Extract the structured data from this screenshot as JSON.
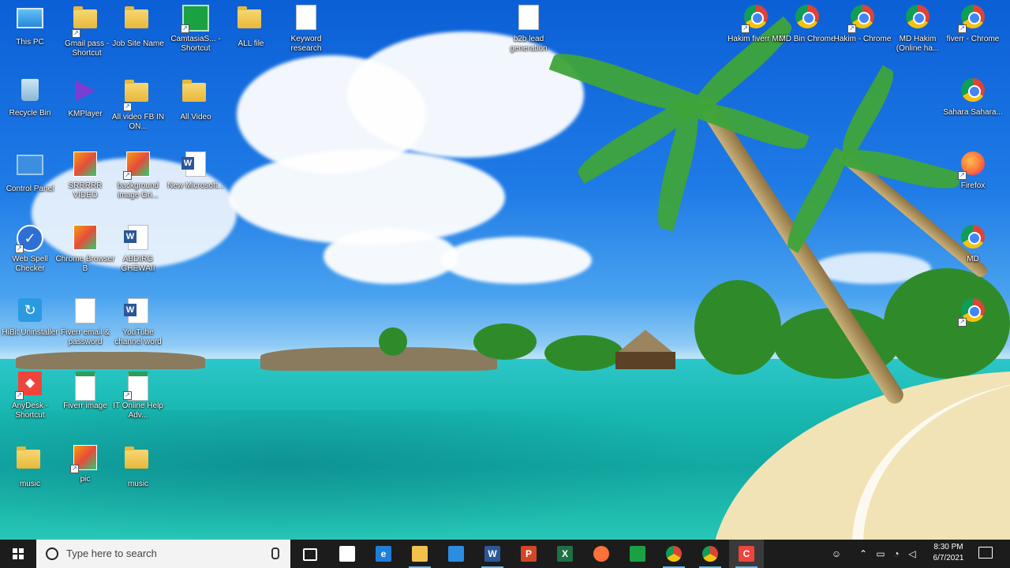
{
  "desktop_icons": [
    {
      "name": "this-pc",
      "label": "This PC",
      "type": "pc"
    },
    {
      "name": "gmail-pass",
      "label": "Gmail pass - Shortcut",
      "type": "folder"
    },
    {
      "name": "job-site-name",
      "label": "Job Site Name",
      "type": "folder"
    },
    {
      "name": "camtasia",
      "label": "CamtasiaS... - Shortcut",
      "type": "camtasia"
    },
    {
      "name": "all-file",
      "label": "ALL file",
      "type": "folder"
    },
    {
      "name": "keyword-research",
      "label": "Keyword research",
      "type": "doc"
    },
    {
      "name": "b2b-lead",
      "label": "b2b lead generation",
      "type": "doc"
    },
    {
      "name": "recycle-bin",
      "label": "Recycle Bin",
      "type": "bin"
    },
    {
      "name": "kmplayer",
      "label": "KMPlayer",
      "type": "kmp"
    },
    {
      "name": "all-video-fb",
      "label": "All video FB IN ON...",
      "type": "folder"
    },
    {
      "name": "all-video",
      "label": "All Video",
      "type": "folder"
    },
    {
      "name": "control-panel",
      "label": "Control Panel",
      "type": "cp"
    },
    {
      "name": "img-file-1",
      "label": "SRRRRR VIDEO",
      "type": "img"
    },
    {
      "name": "background-image",
      "label": "background image Gri...",
      "type": "img"
    },
    {
      "name": "new-microsoft",
      "label": "New Microsoft...",
      "type": "word"
    },
    {
      "name": "spell-checker",
      "label": "Web Spell Checker",
      "type": "check"
    },
    {
      "name": "chrome-browser",
      "label": "Chrome Browser B",
      "type": "img"
    },
    {
      "name": "word-file-2",
      "label": "ABDIRG GHEWAII",
      "type": "word"
    },
    {
      "name": "uninstaller",
      "label": "HiBit Uninstaller",
      "type": "uni"
    },
    {
      "name": "fiverr-email",
      "label": "Fiverr email & password",
      "type": "doc"
    },
    {
      "name": "youtube-word",
      "label": "YouTube channel word",
      "type": "word"
    },
    {
      "name": "anydesk",
      "label": "AnyDesk - Shortcut",
      "type": "anydesk"
    },
    {
      "name": "fiverr-image",
      "label": "Fiverr image",
      "type": "pdf"
    },
    {
      "name": "it-online-help",
      "label": "IT Online Help Adv...",
      "type": "pdf"
    },
    {
      "name": "folder-music",
      "label": "music",
      "type": "folder"
    },
    {
      "name": "folder-pic",
      "label": "pic",
      "type": "img"
    },
    {
      "name": "folder-music-2",
      "label": "music",
      "type": "folder"
    },
    {
      "name": "chrome-hakim-fiverr",
      "label": "Hakim fiverr MD",
      "type": "chrome"
    },
    {
      "name": "chrome-md-bin",
      "label": "MD Bin Chrome",
      "type": "chrome"
    },
    {
      "name": "chrome-hakim",
      "label": "Hakim - Chrome",
      "type": "chrome"
    },
    {
      "name": "chrome-md-hakim",
      "label": "MD Hakim (Online ha...",
      "type": "chrome"
    },
    {
      "name": "chrome-fiverr",
      "label": "fiverr - Chrome",
      "type": "chrome"
    },
    {
      "name": "chrome-sahara",
      "label": "Sahara Sahara...",
      "type": "chrome"
    },
    {
      "name": "firefox",
      "label": "Firefox",
      "type": "firefox"
    },
    {
      "name": "chrome-md",
      "label": "MD",
      "type": "chrome"
    },
    {
      "name": "chrome-plain",
      "label": "",
      "type": "chrome"
    }
  ],
  "taskbar": {
    "search_placeholder": "Type here to search",
    "apps": [
      {
        "name": "task-view",
        "icon": "task-view-icon",
        "label": "",
        "color": "#1c1c1c"
      },
      {
        "name": "store",
        "icon": "store-icon",
        "label": "",
        "color": "#ffffff"
      },
      {
        "name": "edge",
        "icon": "edge-icon",
        "label": "e",
        "color": "#1e7fd8"
      },
      {
        "name": "file-explorer",
        "icon": "folder-icon",
        "label": "",
        "color": "#f3c14b"
      },
      {
        "name": "mail",
        "icon": "mail-icon",
        "label": "",
        "color": "#2b8de0"
      },
      {
        "name": "word",
        "icon": "word-icon",
        "label": "W",
        "color": "#2b5797"
      },
      {
        "name": "powerpoint",
        "icon": "powerpoint-icon",
        "label": "P",
        "color": "#d24726"
      },
      {
        "name": "excel",
        "icon": "excel-icon",
        "label": "X",
        "color": "#1e7145"
      },
      {
        "name": "firefox",
        "icon": "firefox-icon",
        "label": "",
        "color": "#ff7139"
      },
      {
        "name": "camtasia",
        "icon": "camtasia-icon",
        "label": "",
        "color": "#1ba142"
      },
      {
        "name": "chrome-1",
        "icon": "chrome-icon",
        "label": "",
        "color": "#db4437"
      },
      {
        "name": "chrome-2",
        "icon": "chrome-icon",
        "label": "",
        "color": "#db4437"
      },
      {
        "name": "camtasia-recorder",
        "icon": "recorder-icon",
        "label": "C",
        "color": "#ef443b"
      }
    ],
    "clock_time": "8:30 PM",
    "clock_date": "6/7/2021"
  }
}
